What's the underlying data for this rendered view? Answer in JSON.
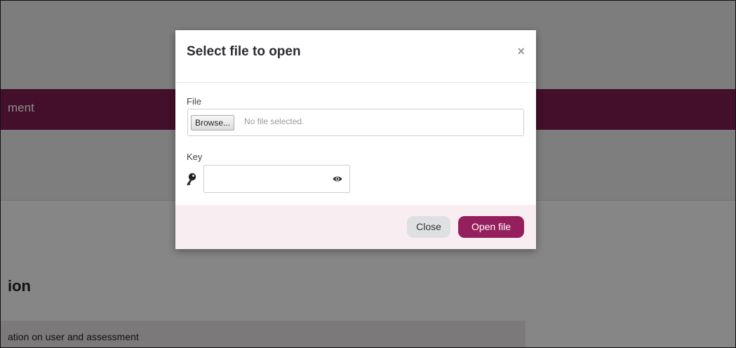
{
  "background": {
    "band_text": "ment",
    "heading": "ion",
    "panel_text": "ation on user and assessment",
    "band_color": "#7a1c4e"
  },
  "modal": {
    "title": "Select file to open",
    "close_icon": "×",
    "file_label": "File",
    "browse_label": "Browse...",
    "file_status": "No file selected.",
    "key_label": "Key",
    "key_value": "",
    "key_icon": "key-icon",
    "eye_icon": "eye-icon",
    "close_button": "Close",
    "open_button": "Open file",
    "accent_color": "#951f5c"
  }
}
